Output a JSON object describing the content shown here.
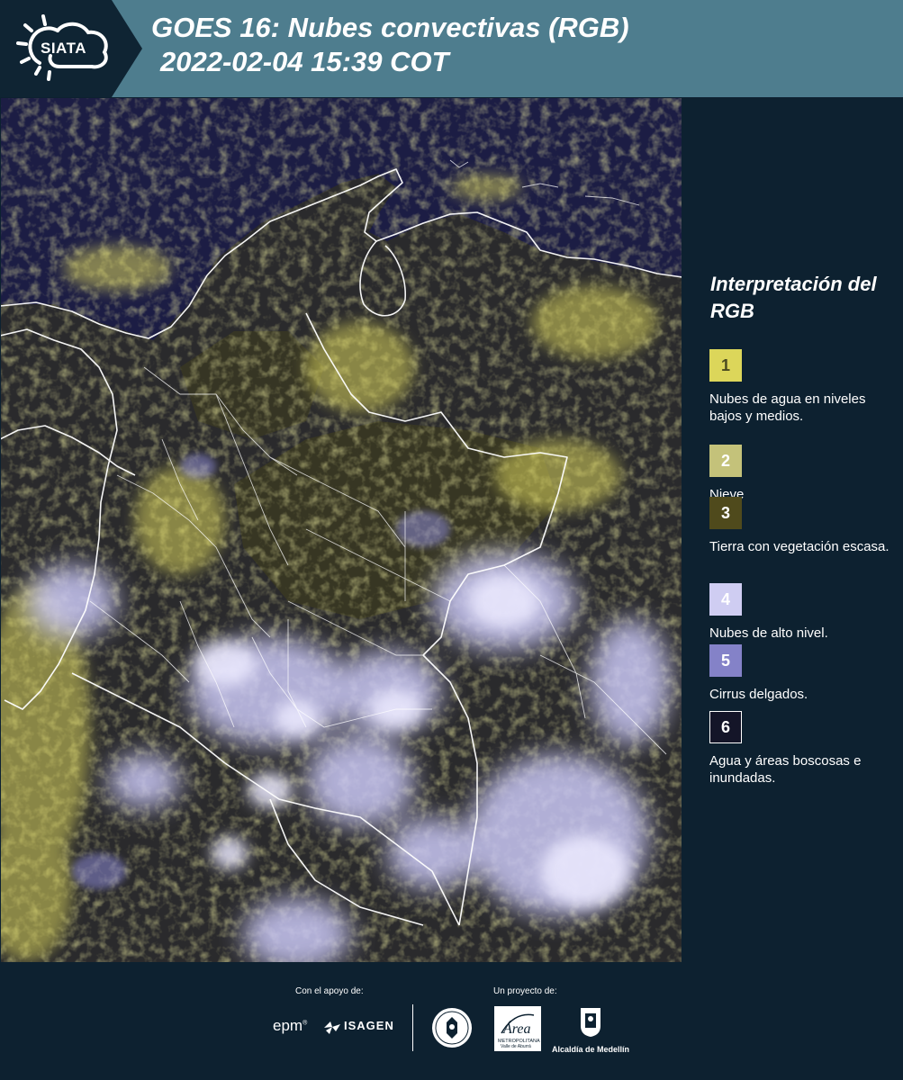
{
  "header": {
    "logo_text": "SIATA",
    "title_line1": "GOES 16: Nubes convectivas (RGB)",
    "title_line2": "2022-02-04 15:39 COT"
  },
  "legend": {
    "title": "Interpretación del RGB",
    "items": [
      {
        "num": "1",
        "color": "#dcd65a",
        "num_color": "#4a4a20",
        "label": "Nubes de agua en niveles bajos y medios."
      },
      {
        "num": "2",
        "color": "#c4c27a",
        "num_color": "#ffffff",
        "label": "Nieve"
      },
      {
        "num": "3",
        "color": "#4f4a1c",
        "num_color": "#ffffff",
        "label": "Tierra con vegetación escasa."
      },
      {
        "num": "4",
        "color": "#cfcdf2",
        "num_color": "#ffffff",
        "label": "Nubes de alto nivel."
      },
      {
        "num": "5",
        "color": "#8482c8",
        "num_color": "#ffffff",
        "label": "Cirrus delgados."
      },
      {
        "num": "6",
        "color": "#141528",
        "num_color": "#ffffff",
        "label": "Agua y áreas boscosas e inundadas."
      }
    ]
  },
  "footer": {
    "support_label": "Con el apoyo de:",
    "project_label": "Un proyecto de:",
    "epm": "epm",
    "isagen": "ISAGEN",
    "amva_name": "Área",
    "amva_sub1": "METROPOLITANA",
    "amva_sub2": "Valle de Aburrá",
    "alcaldia": "Alcaldía de Medellín"
  },
  "colors": {
    "header_bg": "#4e7d8e",
    "panel_bg": "#0d2130",
    "ocean": "#1c1d44",
    "low_cloud": "#dcd65a",
    "high_cloud": "#cfcdf2"
  }
}
